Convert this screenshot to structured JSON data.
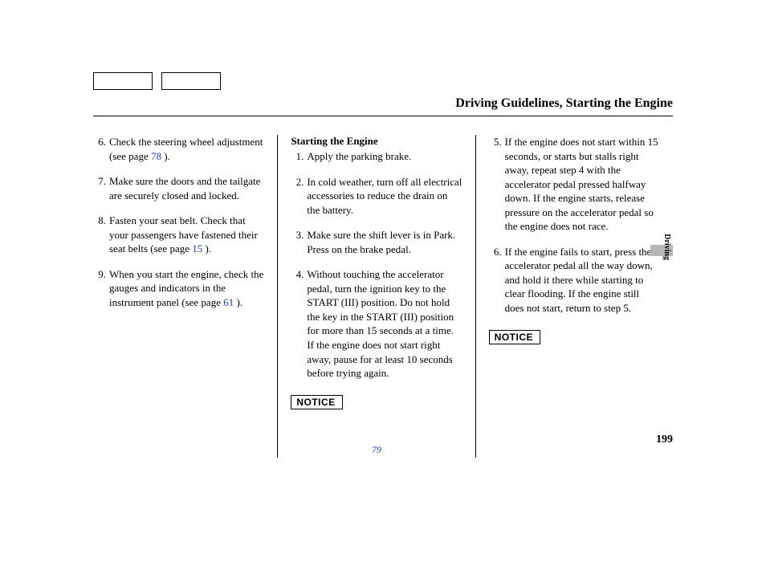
{
  "title": "Driving Guidelines, Starting the Engine",
  "side_label": "Driving",
  "page_number": "199",
  "notice_label": "NOTICE",
  "col2_footer_link": "79",
  "col1": {
    "items": [
      {
        "num": "6.",
        "text_pre": "Check the steering wheel adjustment (see page ",
        "link": "78",
        "text_post": " )."
      },
      {
        "num": "7.",
        "text": "Make sure the doors and the tailgate are securely closed and locked."
      },
      {
        "num": "8.",
        "text_pre": "Fasten your seat belt. Check that your passengers have fastened their seat belts (see page ",
        "link": "15",
        "text_post": " )."
      },
      {
        "num": "9.",
        "text_pre": "When you start the engine, check the gauges and indicators in the instrument panel (see page ",
        "link": "61",
        "text_post": " )."
      }
    ]
  },
  "col2": {
    "heading": "Starting the Engine",
    "items": [
      {
        "num": "1.",
        "text": "Apply the parking brake."
      },
      {
        "num": "2.",
        "text": "In cold weather, turn off all electrical accessories to reduce the drain on the battery."
      },
      {
        "num": "3.",
        "text": "Make sure the shift lever is in Park. Press on the brake pedal."
      },
      {
        "num": "4.",
        "text": "Without touching the accelerator pedal, turn the ignition key to the START (III) position. Do not hold the key in the START (III) position for more than 15 seconds at a time. If the engine does not start right away, pause for at least 10 seconds before trying again."
      }
    ]
  },
  "col3": {
    "items": [
      {
        "num": "5.",
        "text": "If the engine does not start within 15 seconds, or starts but stalls right away, repeat step 4 with the accelerator pedal pressed halfway down. If the engine starts, release pressure on the accelerator pedal so the engine does not race."
      },
      {
        "num": "6.",
        "text": "If the engine fails to start, press the accelerator pedal all the way down, and hold it there while starting to clear flooding. If the engine still does not start, return to step 5."
      }
    ]
  }
}
